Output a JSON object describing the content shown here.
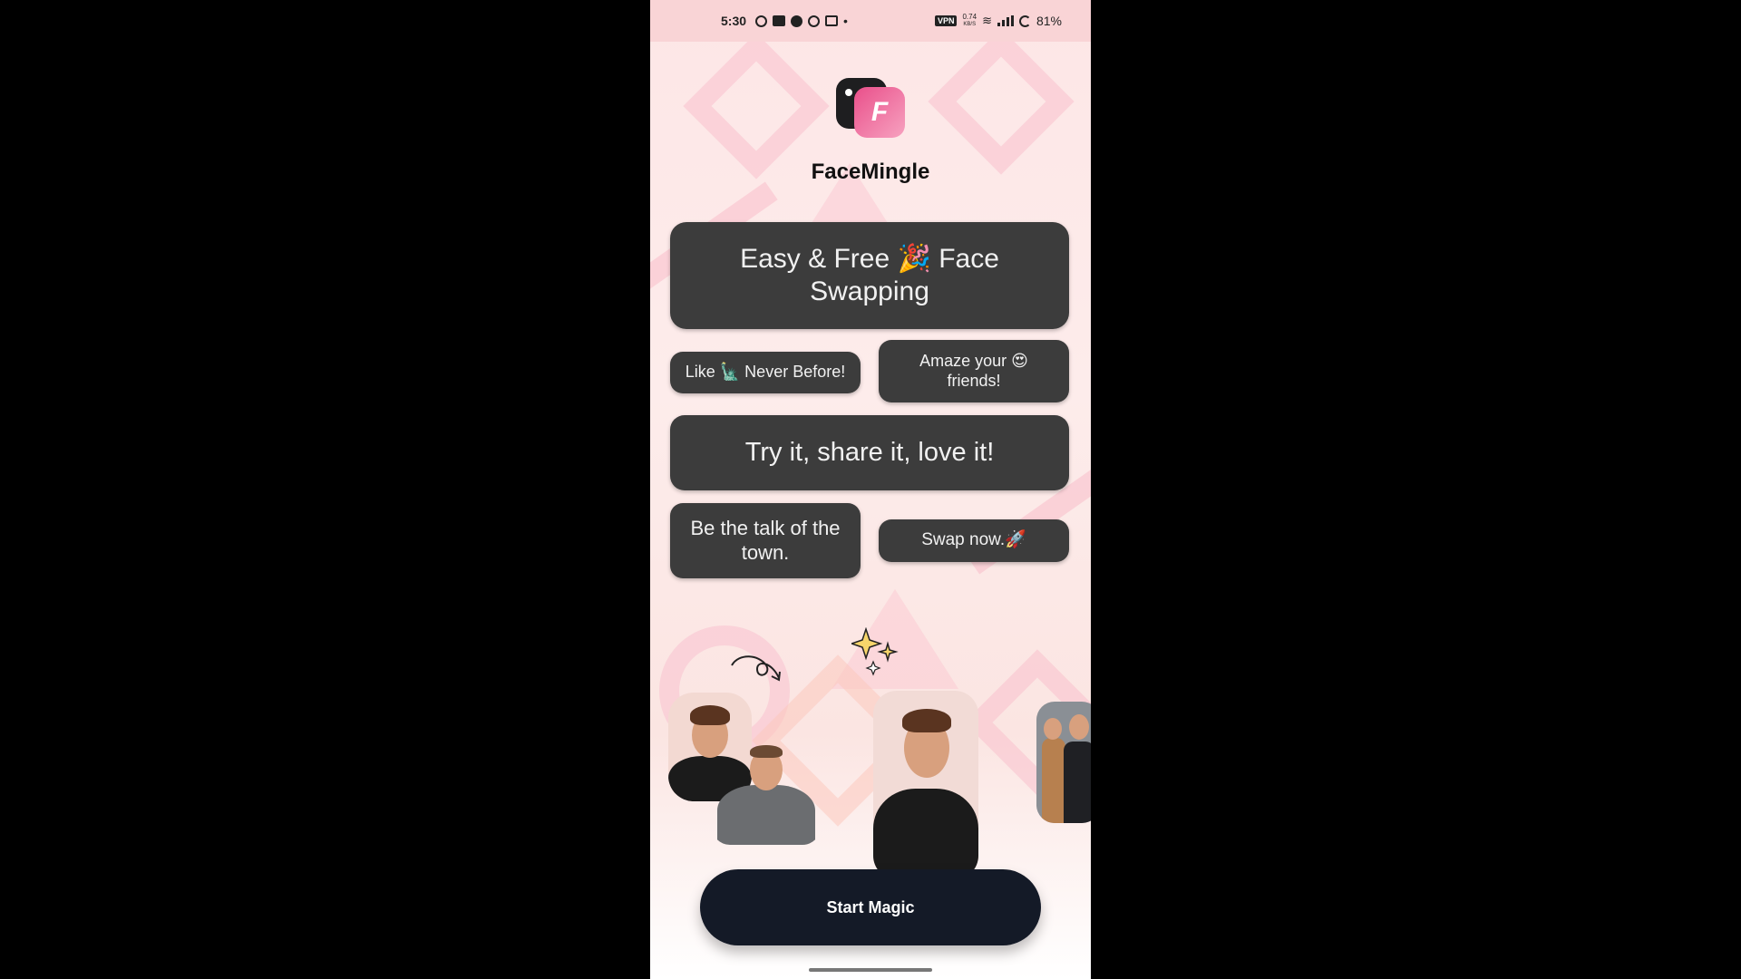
{
  "status_bar": {
    "time": "5:30",
    "vpn": "VPN",
    "speed_value": "0.74",
    "speed_unit": "KB/S",
    "battery": "81%"
  },
  "app": {
    "name": "FaceMingle",
    "logo_letter": "F"
  },
  "taglines": {
    "headline": "Easy & Free 🎉 Face Swapping",
    "never_before": "Like 🗽 Never Before!",
    "amaze": "Amaze your 😍 friends!",
    "try_it": "Try it, share it, love it!",
    "talk_of_town": "Be the talk of the town.",
    "swap_now": "Swap now.🚀"
  },
  "cta": {
    "start_label": "Start Magic"
  },
  "colors": {
    "button_bg": "#141a27",
    "pill_bg": "#3c3c3c",
    "accent_pink": "#e94f8a"
  }
}
